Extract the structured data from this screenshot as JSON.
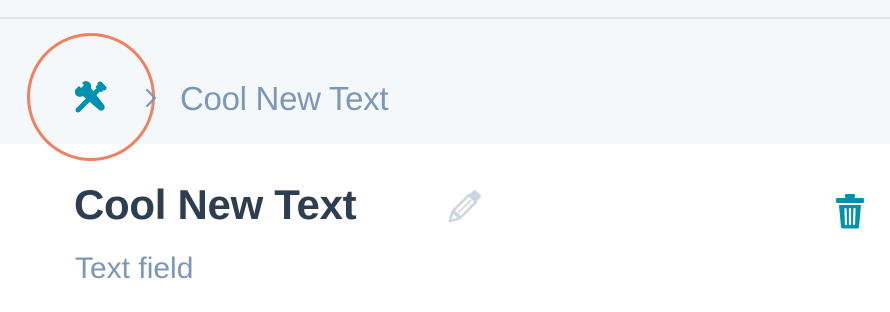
{
  "header": {
    "tools_icon": "wrench-screwdriver-icon",
    "breadcrumb_separator_icon": "chevron-right-icon",
    "breadcrumb_current": "Cool New Text"
  },
  "field": {
    "title": "Cool New Text",
    "edit_icon": "pencil-icon",
    "subtitle": "Text field",
    "delete_icon": "trash-icon"
  },
  "colors": {
    "accent_teal": "#0091ae",
    "highlight_ring": "#f08060",
    "title_text": "#2d3e50",
    "muted_text": "#7c98b6",
    "band_background": "#f5f8fa",
    "pencil_gray": "#cbd6e2"
  }
}
